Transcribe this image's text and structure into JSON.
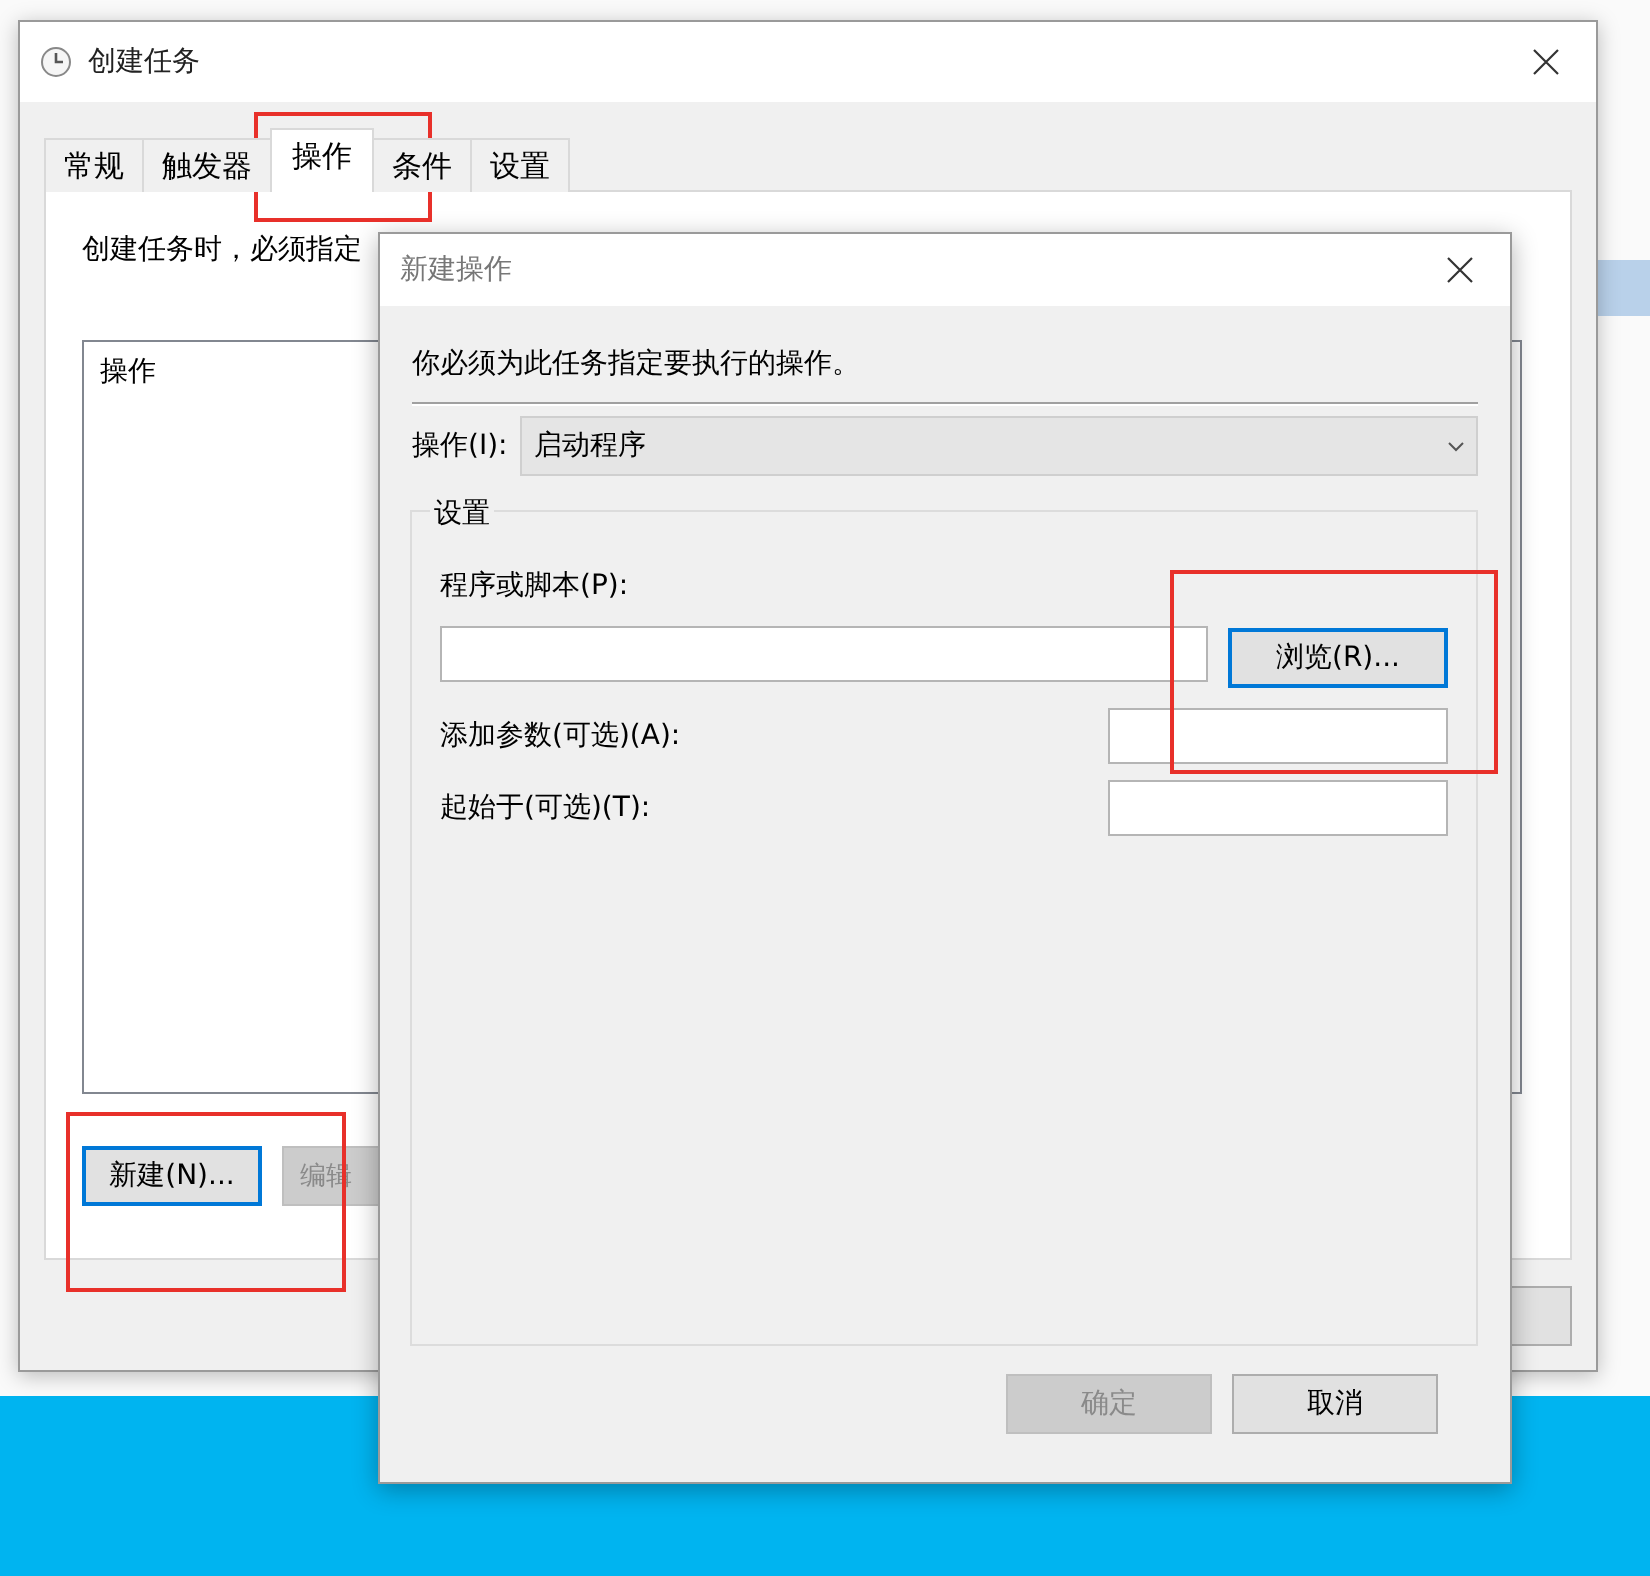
{
  "main_window": {
    "title": "创建任务",
    "tabs": [
      {
        "label": "常规",
        "selected": false
      },
      {
        "label": "触发器",
        "selected": false
      },
      {
        "label": "操作",
        "selected": true
      },
      {
        "label": "条件",
        "selected": false
      },
      {
        "label": "设置",
        "selected": false
      }
    ],
    "instruction": "创建任务时，必须指定",
    "actions_list": {
      "header": "操作"
    },
    "buttons": [
      {
        "label": "新建(N)...",
        "focused": true,
        "disabled": false
      },
      {
        "label": "编辑",
        "focused": false,
        "disabled": true
      }
    ]
  },
  "dialog": {
    "title": "新建操作",
    "instruction": "你必须为此任务指定要执行的操作。",
    "action": {
      "label": "操作(I):",
      "value": "启动程序"
    },
    "settings": {
      "title": "设置",
      "program": {
        "label": "程序或脚本(P):",
        "browse": "浏览(R)..."
      },
      "arguments": {
        "label": "添加参数(可选)(A):"
      },
      "start_in": {
        "label": "起始于(可选)(T):"
      }
    },
    "buttons": [
      {
        "label": "确定",
        "disabled": true
      },
      {
        "label": "取消",
        "disabled": false
      }
    ]
  }
}
